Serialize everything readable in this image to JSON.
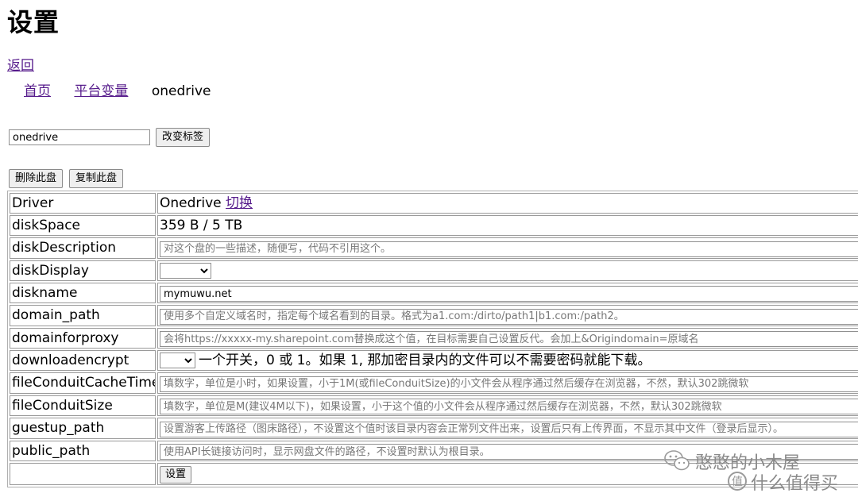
{
  "page": {
    "title": "设置",
    "back_link": "返回",
    "breadcrumb": {
      "home": "首页",
      "platform_vars": "平台变量",
      "current": "onedrive"
    }
  },
  "tag_form": {
    "tag_value": "onedrive",
    "change_tag_button": "改变标签"
  },
  "actions": {
    "delete_disk_button": "删除此盘",
    "copy_disk_button": "复制此盘"
  },
  "config": {
    "driver": {
      "label": "Driver",
      "value": "Onedrive",
      "switch_link": "切换"
    },
    "disk_space": {
      "label": "diskSpace",
      "value": "359 B / 5 TB"
    },
    "disk_description": {
      "label": "diskDescription",
      "value": "",
      "placeholder": "对这个盘的一些描述，随便写，代码不引用这个。"
    },
    "disk_display": {
      "label": "diskDisplay",
      "value": ""
    },
    "disk_name": {
      "label": "diskname",
      "value": "mymuwu.net"
    },
    "domain_path": {
      "label": "domain_path",
      "value": "",
      "placeholder": "使用多个自定义域名时，指定每个域名看到的目录。格式为a1.com:/dirto/path1|b1.com:/path2。"
    },
    "domain_for_proxy": {
      "label": "domainforproxy",
      "value": "",
      "placeholder": "会将https://xxxxx-my.sharepoint.com替换成这个值，在目标需要自己设置反代。会加上&Origindomain=原域名"
    },
    "download_encrypt": {
      "label": "downloadencrypt",
      "value": "",
      "note": "一个开关，0 或 1。如果 1, 那加密目录内的文件可以不需要密码就能下载。"
    },
    "file_conduit_cache_time": {
      "label": "fileConduitCacheTime",
      "value": "",
      "placeholder": "填数字，单位是小时，如果设置，小于1M(或fileConduitSize)的小文件会从程序通过然后缓存在浏览器，不然，默认302跳微软"
    },
    "file_conduit_size": {
      "label": "fileConduitSize",
      "value": "",
      "placeholder": "填数字，单位是M(建议4M以下)，如果设置，小于这个值的小文件会从程序通过然后缓存在浏览器，不然，默认302跳微软"
    },
    "guestup_path": {
      "label": "guestup_path",
      "value": "",
      "placeholder": "设置游客上传路径（图床路径），不设置这个值时该目录内容会正常列文件出来，设置后只有上传界面，不显示其中文件（登录后显示）。"
    },
    "public_path": {
      "label": "public_path",
      "value": "",
      "placeholder": "使用API长链接访问时，显示网盘文件的路径，不设置时默认为根目录。"
    },
    "submit_button": "设置"
  },
  "watermark": {
    "line1": "憨憨的小木屋",
    "line2": "什么值得买"
  }
}
